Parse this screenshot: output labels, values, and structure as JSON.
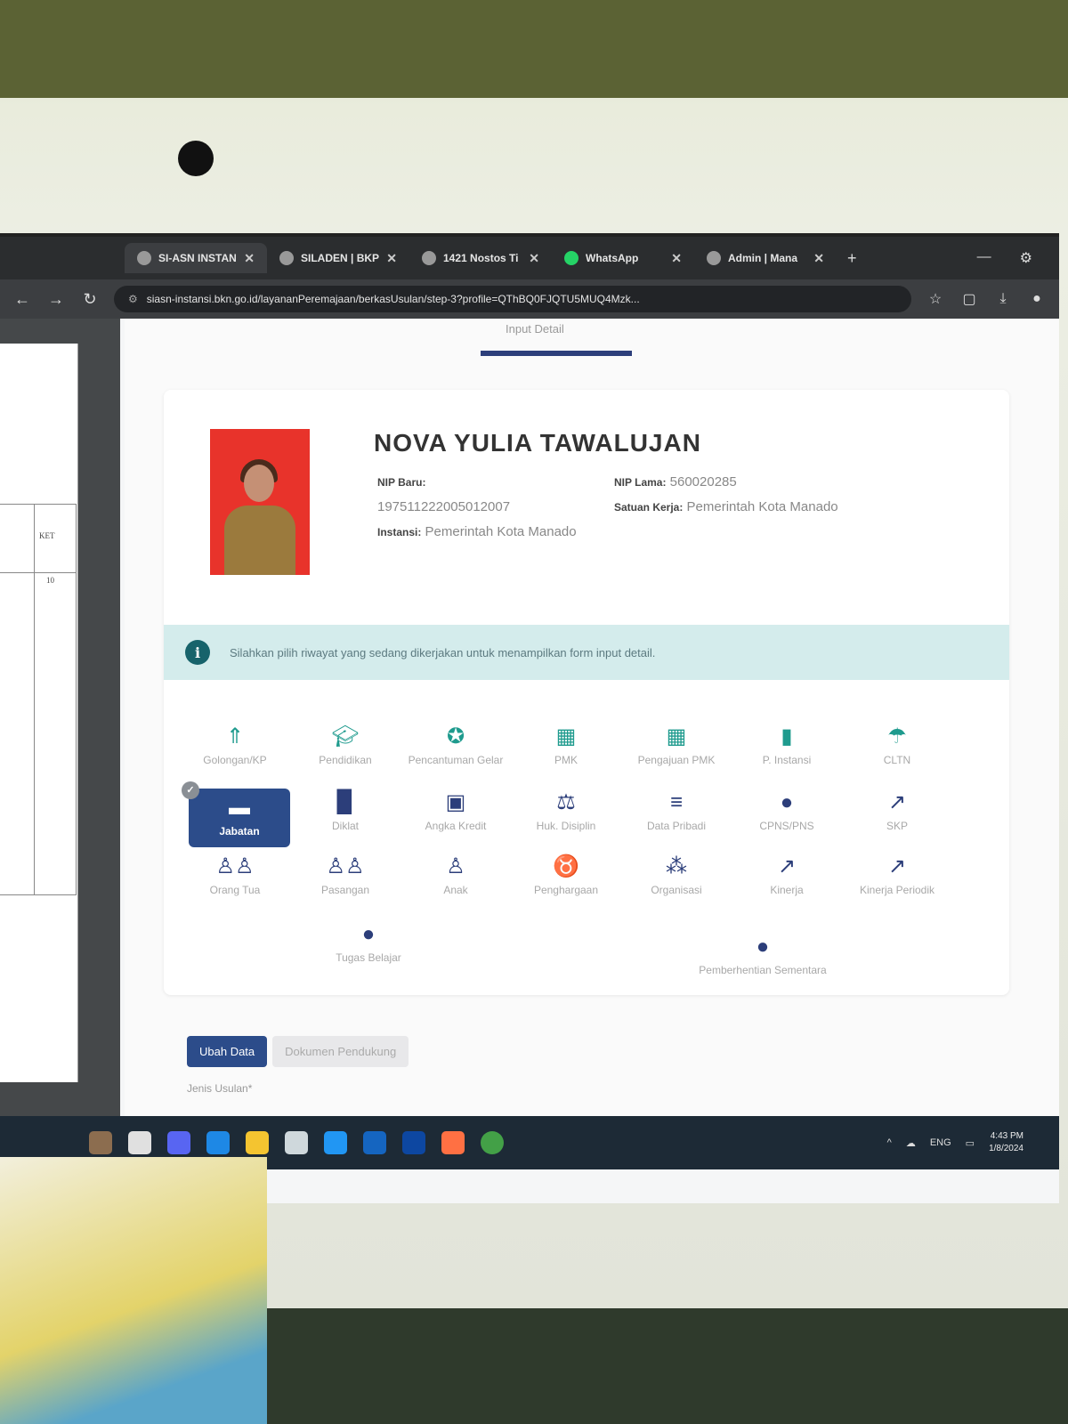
{
  "browser": {
    "tabs": [
      {
        "label": "SI-ASN INSTAN",
        "active": true
      },
      {
        "label": "SILADEN | BKP",
        "active": false
      },
      {
        "label": "1421 Nostos Ti",
        "active": false
      },
      {
        "label": "WhatsApp",
        "active": false
      },
      {
        "label": "Admin | Mana",
        "active": false
      }
    ],
    "url": "siasn-instansi.bkn.go.id/layananPeremajaan/berkasUsulan/step-3?profile=QThBQ0FJQTU5MUQ4Mzk..."
  },
  "left_doc": {
    "col_header": "KET",
    "row_value": "10"
  },
  "stepper": {
    "current": "Input Detail"
  },
  "profile": {
    "name": "NOVA YULIA TAWALUJAN",
    "nip_baru_label": "NIP Baru:",
    "nip_baru": "197511222005012007",
    "instansi_label": "Instansi:",
    "instansi": "Pemerintah Kota Manado",
    "nip_lama_label": "NIP Lama:",
    "nip_lama": "560020285",
    "satuan_kerja_label": "Satuan Kerja:",
    "satuan_kerja": "Pemerintah Kota Manado"
  },
  "alert": {
    "text": "Silahkan pilih riwayat yang sedang dikerjakan untuk menampilkan form input detail."
  },
  "menu": [
    {
      "label": "Golongan/KP",
      "icon": "person-up-icon"
    },
    {
      "label": "Pendidikan",
      "icon": "graduation-cap-icon"
    },
    {
      "label": "Pencantuman Gelar",
      "icon": "award-icon"
    },
    {
      "label": "PMK",
      "icon": "calendar-icon"
    },
    {
      "label": "Pengajuan PMK",
      "icon": "calendar-icon"
    },
    {
      "label": "P. Instansi",
      "icon": "building-icon"
    },
    {
      "label": "CLTN",
      "icon": "beach-umbrella-icon"
    },
    {
      "label": "Jabatan",
      "icon": "id-card-icon"
    },
    {
      "label": "Diklat",
      "icon": "book-icon"
    },
    {
      "label": "Angka Kredit",
      "icon": "money-icon"
    },
    {
      "label": "Huk. Disiplin",
      "icon": "scale-icon"
    },
    {
      "label": "Data Pribadi",
      "icon": "database-icon"
    },
    {
      "label": "CPNS/PNS",
      "icon": "user-tie-icon"
    },
    {
      "label": "SKP",
      "icon": "chart-line-icon"
    },
    {
      "label": "Orang Tua",
      "icon": "family-icon"
    },
    {
      "label": "Pasangan",
      "icon": "couple-icon"
    },
    {
      "label": "Anak",
      "icon": "child-icon"
    },
    {
      "label": "Penghargaan",
      "icon": "medal-icon"
    },
    {
      "label": "Organisasi",
      "icon": "network-icon"
    },
    {
      "label": "Kinerja",
      "icon": "chart-line-icon"
    },
    {
      "label": "Kinerja Periodik",
      "icon": "chart-line-icon"
    },
    {
      "label": "Tugas Belajar",
      "icon": "user-graduate-icon"
    },
    {
      "label": "Pemberhentian Sementara",
      "icon": "user-minus-icon"
    }
  ],
  "selected_menu": "Jabatan",
  "form": {
    "tab_edit": "Ubah Data",
    "tab_docs": "Dokumen Pendukung",
    "jenis_label": "Jenis Usulan*"
  },
  "taskbar": {
    "time": "4:43 PM",
    "date": "1/8/2024",
    "lang": "ENG"
  },
  "colors": {
    "primary": "#2c4c8a",
    "accent": "#1f9b8e",
    "alert_bg": "#d4ecec",
    "photo_bg": "#e8332b"
  }
}
